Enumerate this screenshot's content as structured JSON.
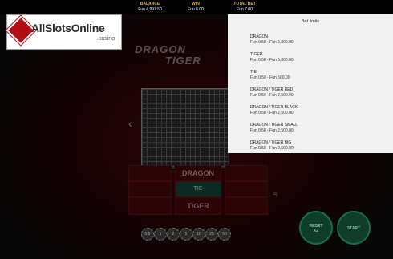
{
  "header": {
    "balance": {
      "label": "BALANCE",
      "value": "Fun 4,997.50"
    },
    "win": {
      "label": "WIN",
      "value": "Fun 6.00"
    },
    "total_bet": {
      "label": "TOTAL BET",
      "value": "Fun 7.00"
    }
  },
  "logo": {
    "brand": "AllSlotsOnline",
    "sub": ".casino"
  },
  "game_title": {
    "line1": "DRAGON",
    "line2": "TIGER"
  },
  "bet_areas": {
    "top_left": "",
    "top_center": "DRAGON",
    "top_right": "",
    "mid_center": "TIE",
    "bottom_center": "TIGER"
  },
  "chips": [
    "0.5",
    "1",
    "2",
    "5",
    "10",
    "25",
    "50"
  ],
  "buttons": {
    "rebet": {
      "line1": "REBET",
      "line2": "X2"
    },
    "start": "START"
  },
  "bet_limits": {
    "title": "Bet limits",
    "items": [
      {
        "name": "DRAGON",
        "range": "Fun 0.50 - Fun 5,000.00"
      },
      {
        "name": "TIGER",
        "range": "Fun 0.50 - Fun 5,000.00"
      },
      {
        "name": "TIE",
        "range": "Fun 0.50 - Fun 500.00"
      },
      {
        "name": "DRAGON / TIGER RED",
        "range": "Fun 0.50 - Fun 2,500.00"
      },
      {
        "name": "DRAGON / TIGER BLACK",
        "range": "Fun 0.50 - Fun 2,500.00"
      },
      {
        "name": "DRAGON / TIGER SMALL",
        "range": "Fun 0.50 - Fun 2,500.00"
      },
      {
        "name": "DRAGON / TIGER BIG",
        "range": "Fun 0.50 - Fun 2,500.00"
      }
    ]
  },
  "colors": {
    "accent_gold": "#d9b04a",
    "table_red": "#2a0407",
    "felt_green": "#0e3d2a"
  }
}
